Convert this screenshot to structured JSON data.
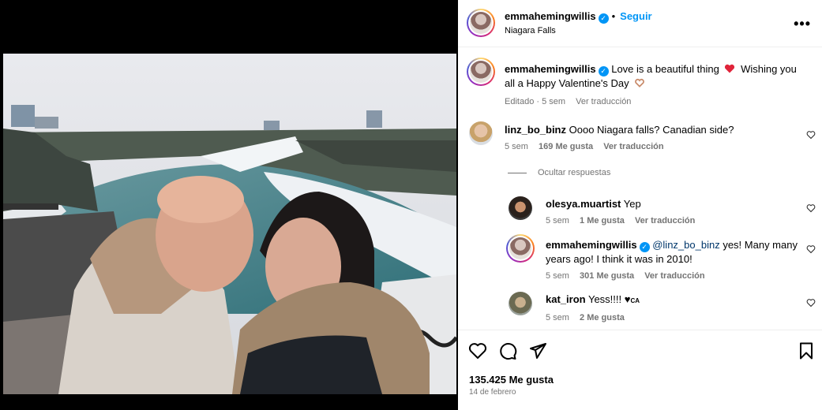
{
  "post": {
    "username": "emmahemingwillis",
    "verified_mark": "✓",
    "separator": "•",
    "follow_label": "Seguir",
    "location": "Niagara Falls",
    "more_label": "•••",
    "caption": {
      "username": "emmahemingwillis",
      "text_a": "Love is a beautiful thing",
      "text_b": "Wishing you all a Happy Valentine's Day",
      "edited": "Editado · 5 sem",
      "translate": "Ver traducción"
    },
    "likes": "135.425 Me gusta",
    "date": "14 de febrero"
  },
  "comments": [
    {
      "username": "linz_bo_binz",
      "text": "Oooo Niagara falls? Canadian side?",
      "time": "5 sem",
      "likes": "169 Me gusta",
      "translate": "Ver traducción"
    }
  ],
  "hide_replies_label": "Ocultar respuestas",
  "replies": [
    {
      "username": "olesya.muartist",
      "text": "Yep",
      "time": "5 sem",
      "likes": "1 Me gusta",
      "translate": "Ver traducción"
    },
    {
      "username": "emmahemingwillis",
      "mention": "@linz_bo_binz",
      "text": "yes! Many many years ago! I think it was in 2010!",
      "time": "5 sem",
      "likes": "301 Me gusta",
      "translate": "Ver traducción"
    },
    {
      "username": "kat_iron",
      "text": "Yess!!!! ♥",
      "flag": "CA",
      "time": "5 sem",
      "likes": "2 Me gusta"
    }
  ],
  "icons": [
    "heart-icon",
    "comment-icon",
    "share-icon",
    "bookmark-icon",
    "more-icon",
    "verified-icon"
  ],
  "colors": {
    "accent": "#0095f6",
    "muted": "#737373",
    "heart_red": "#ed4956"
  }
}
